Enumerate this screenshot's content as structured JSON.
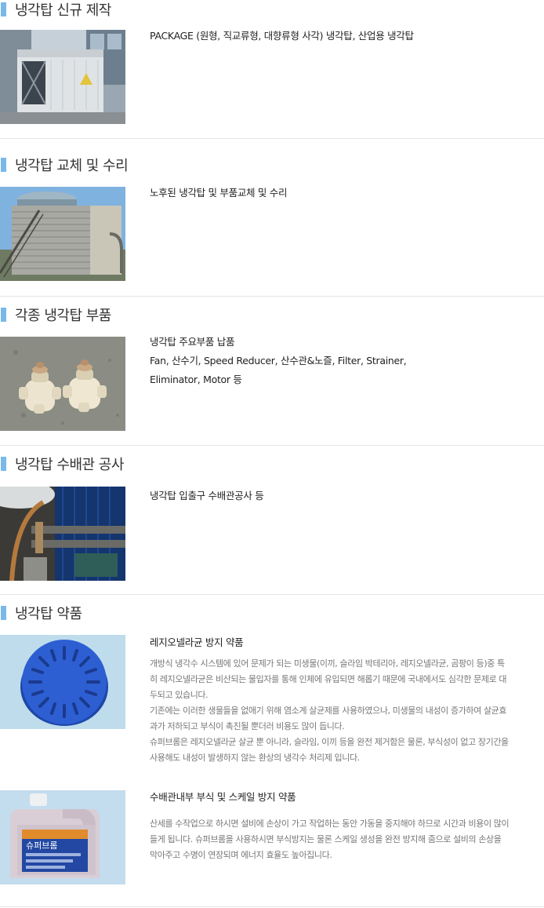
{
  "sections": [
    {
      "title": "냉각탑 신규 제작",
      "lines": [
        "PACKAGE (원형, 직교류형, 대향류형 사각) 냉각탑, 산업용 냉각탑"
      ],
      "image": "cooling-tower-package-photo"
    },
    {
      "title": "냉각탑 교체 및 수리",
      "lines": [
        "노후된 냉각탑 및 부품교체 및 수리"
      ],
      "image": "cooling-tower-repair-photo"
    },
    {
      "title": "각종 냉각탑 부품",
      "lines": [
        "냉각탑 주요부품 납품",
        "Fan, 산수기, Speed Reducer, 산수관&노즐, Filter, Strainer,",
        "Eliminator, Motor  등"
      ],
      "image": "cooling-tower-parts-photo"
    },
    {
      "title": "냉각탑 수배관 공사",
      "lines": [
        "냉각탑 입출구 수배관공사 등"
      ],
      "image": "piping-work-photo"
    },
    {
      "title": "냉각탑 약품"
    }
  ],
  "chemicals": [
    {
      "heading": "레지오넬라균 방지 약품",
      "image": "legionella-tablet-photo",
      "paragraphs": [
        "개방식 냉각수 시스템에 있어 문제가 되는 미생물(이끼, 슬라임 박테리아, 레지오넬라균, 곰팡이 등)중 특",
        "히 레지오넬라균은 비산되는 물입자를 통해 인체에 유입되면 해롭기 때문에 국내에서도 심각한 문제로 대",
        "두되고 있습니다.",
        "기존에는 이러한 생물들을 없애기 위해 염소계 살균제를 사용하였으나, 미생물의 내성이 증가하여 살균효",
        "과가 저하되고 부식이 촉진될 뿐더러 비용도 많이 듭니다.",
        "슈퍼브롬은 레지오넬라균 살균 뿐 아니라, 슬라임, 이끼 등을 완전 제거함은 물론, 부식성이 없고 장기간을",
        "사용해도 내성이 발생하지 않는 환상의 냉각수 처리제 입니다."
      ]
    },
    {
      "heading": "수배관내부 부식 및 스케일 방지 약품",
      "image": "anticorrosion-jug-photo",
      "label_text": "슈퍼브롬",
      "paragraphs": [
        "산세를 수작업으로 하시면 설비에 손상이 가고 작업하는 동안 가동을 중지해야 하므로 시간과 비용이 많이",
        "들게 됩니다. 슈퍼브롬을 사용하시면 부식방지는 물론 스케일 생성을 완전 방지해 줌으로 설비의 손상을",
        "막아주고 수명이 연장되며 에너지 효율도 높아집니다."
      ]
    }
  ]
}
